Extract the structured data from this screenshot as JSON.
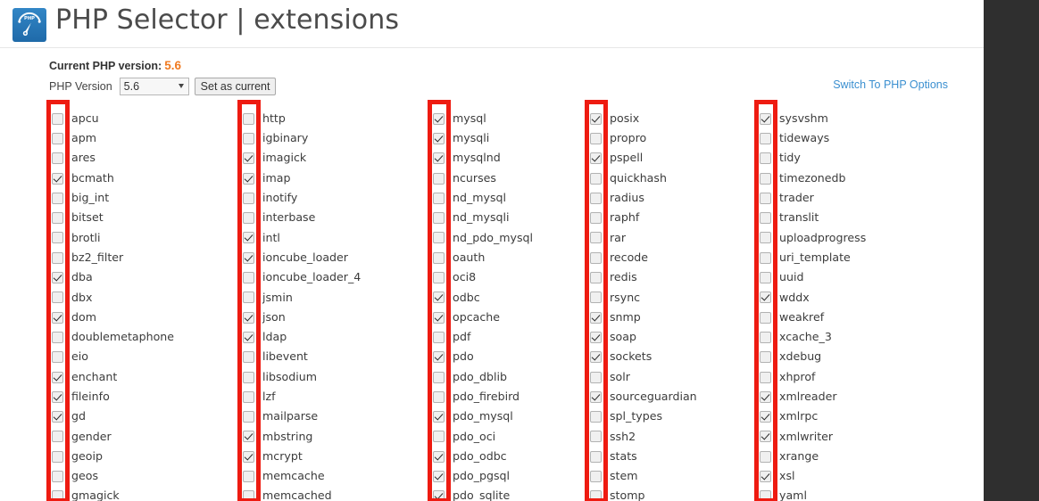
{
  "window": {
    "title": "PHP Selector | extensions"
  },
  "header": {
    "logo_icon": "php-gauge-logo-icon",
    "title": "PHP Selector  |  extensions"
  },
  "version_panel": {
    "current_label": "Current PHP version:",
    "current_value": "5.6",
    "select_label": "PHP Version",
    "selected_version": "5.6",
    "version_options": [
      "5.6"
    ],
    "set_current_label": "Set as current",
    "dropdown_icon": "chevron-down-icon"
  },
  "switch_link": {
    "label": "Switch To PHP Options"
  },
  "colors": {
    "accent_orange": "#f07a20",
    "link_blue": "#3a8fd0",
    "logo_blue": "#2777b8",
    "annotation_red": "#ee1b11",
    "checkbox_border": "#b2b2b2"
  },
  "annotations": {
    "type": "red-rectangle-highlight",
    "count": 5,
    "description": "Red rectangles highlight the checkbox column of each of the five extension columns"
  },
  "extensions": {
    "columns": [
      {
        "index": 0,
        "items": [
          {
            "name": "apcu",
            "checked": false
          },
          {
            "name": "apm",
            "checked": false
          },
          {
            "name": "ares",
            "checked": false
          },
          {
            "name": "bcmath",
            "checked": true
          },
          {
            "name": "big_int",
            "checked": false
          },
          {
            "name": "bitset",
            "checked": false
          },
          {
            "name": "brotli",
            "checked": false
          },
          {
            "name": "bz2_filter",
            "checked": false
          },
          {
            "name": "dba",
            "checked": true
          },
          {
            "name": "dbx",
            "checked": false
          },
          {
            "name": "dom",
            "checked": true
          },
          {
            "name": "doublemetaphone",
            "checked": false
          },
          {
            "name": "eio",
            "checked": false
          },
          {
            "name": "enchant",
            "checked": true
          },
          {
            "name": "fileinfo",
            "checked": true
          },
          {
            "name": "gd",
            "checked": true
          },
          {
            "name": "gender",
            "checked": false
          },
          {
            "name": "geoip",
            "checked": false
          },
          {
            "name": "geos",
            "checked": false
          },
          {
            "name": "gmagick",
            "checked": false
          }
        ]
      },
      {
        "index": 1,
        "items": [
          {
            "name": "http",
            "checked": false
          },
          {
            "name": "igbinary",
            "checked": false
          },
          {
            "name": "imagick",
            "checked": true
          },
          {
            "name": "imap",
            "checked": true
          },
          {
            "name": "inotify",
            "checked": false
          },
          {
            "name": "interbase",
            "checked": false
          },
          {
            "name": "intl",
            "checked": true
          },
          {
            "name": "ioncube_loader",
            "checked": true
          },
          {
            "name": "ioncube_loader_4",
            "checked": false
          },
          {
            "name": "jsmin",
            "checked": false
          },
          {
            "name": "json",
            "checked": true
          },
          {
            "name": "ldap",
            "checked": true
          },
          {
            "name": "libevent",
            "checked": false
          },
          {
            "name": "libsodium",
            "checked": false
          },
          {
            "name": "lzf",
            "checked": false
          },
          {
            "name": "mailparse",
            "checked": false
          },
          {
            "name": "mbstring",
            "checked": true
          },
          {
            "name": "mcrypt",
            "checked": true
          },
          {
            "name": "memcache",
            "checked": false
          },
          {
            "name": "memcached",
            "checked": false
          }
        ]
      },
      {
        "index": 2,
        "items": [
          {
            "name": "mysql",
            "checked": true
          },
          {
            "name": "mysqli",
            "checked": true
          },
          {
            "name": "mysqlnd",
            "checked": true
          },
          {
            "name": "ncurses",
            "checked": false
          },
          {
            "name": "nd_mysql",
            "checked": false
          },
          {
            "name": "nd_mysqli",
            "checked": false
          },
          {
            "name": "nd_pdo_mysql",
            "checked": false
          },
          {
            "name": "oauth",
            "checked": false
          },
          {
            "name": "oci8",
            "checked": false
          },
          {
            "name": "odbc",
            "checked": true
          },
          {
            "name": "opcache",
            "checked": true
          },
          {
            "name": "pdf",
            "checked": false
          },
          {
            "name": "pdo",
            "checked": true
          },
          {
            "name": "pdo_dblib",
            "checked": false
          },
          {
            "name": "pdo_firebird",
            "checked": false
          },
          {
            "name": "pdo_mysql",
            "checked": true
          },
          {
            "name": "pdo_oci",
            "checked": false
          },
          {
            "name": "pdo_odbc",
            "checked": true
          },
          {
            "name": "pdo_pgsql",
            "checked": true
          },
          {
            "name": "pdo_sqlite",
            "checked": true
          }
        ]
      },
      {
        "index": 3,
        "items": [
          {
            "name": "posix",
            "checked": true
          },
          {
            "name": "propro",
            "checked": false
          },
          {
            "name": "pspell",
            "checked": true
          },
          {
            "name": "quickhash",
            "checked": false
          },
          {
            "name": "radius",
            "checked": false
          },
          {
            "name": "raphf",
            "checked": false
          },
          {
            "name": "rar",
            "checked": false
          },
          {
            "name": "recode",
            "checked": false
          },
          {
            "name": "redis",
            "checked": false
          },
          {
            "name": "rsync",
            "checked": false
          },
          {
            "name": "snmp",
            "checked": true
          },
          {
            "name": "soap",
            "checked": true
          },
          {
            "name": "sockets",
            "checked": true
          },
          {
            "name": "solr",
            "checked": false
          },
          {
            "name": "sourceguardian",
            "checked": true
          },
          {
            "name": "spl_types",
            "checked": false
          },
          {
            "name": "ssh2",
            "checked": false
          },
          {
            "name": "stats",
            "checked": false
          },
          {
            "name": "stem",
            "checked": false
          },
          {
            "name": "stomp",
            "checked": false
          }
        ]
      },
      {
        "index": 4,
        "items": [
          {
            "name": "sysvshm",
            "checked": true
          },
          {
            "name": "tideways",
            "checked": false
          },
          {
            "name": "tidy",
            "checked": false
          },
          {
            "name": "timezonedb",
            "checked": false
          },
          {
            "name": "trader",
            "checked": false
          },
          {
            "name": "translit",
            "checked": false
          },
          {
            "name": "uploadprogress",
            "checked": false
          },
          {
            "name": "uri_template",
            "checked": false
          },
          {
            "name": "uuid",
            "checked": false
          },
          {
            "name": "wddx",
            "checked": true
          },
          {
            "name": "weakref",
            "checked": false
          },
          {
            "name": "xcache_3",
            "checked": false
          },
          {
            "name": "xdebug",
            "checked": false
          },
          {
            "name": "xhprof",
            "checked": false
          },
          {
            "name": "xmlreader",
            "checked": true
          },
          {
            "name": "xmlrpc",
            "checked": true
          },
          {
            "name": "xmlwriter",
            "checked": true
          },
          {
            "name": "xrange",
            "checked": false
          },
          {
            "name": "xsl",
            "checked": true
          },
          {
            "name": "yaml",
            "checked": false
          }
        ]
      }
    ]
  }
}
